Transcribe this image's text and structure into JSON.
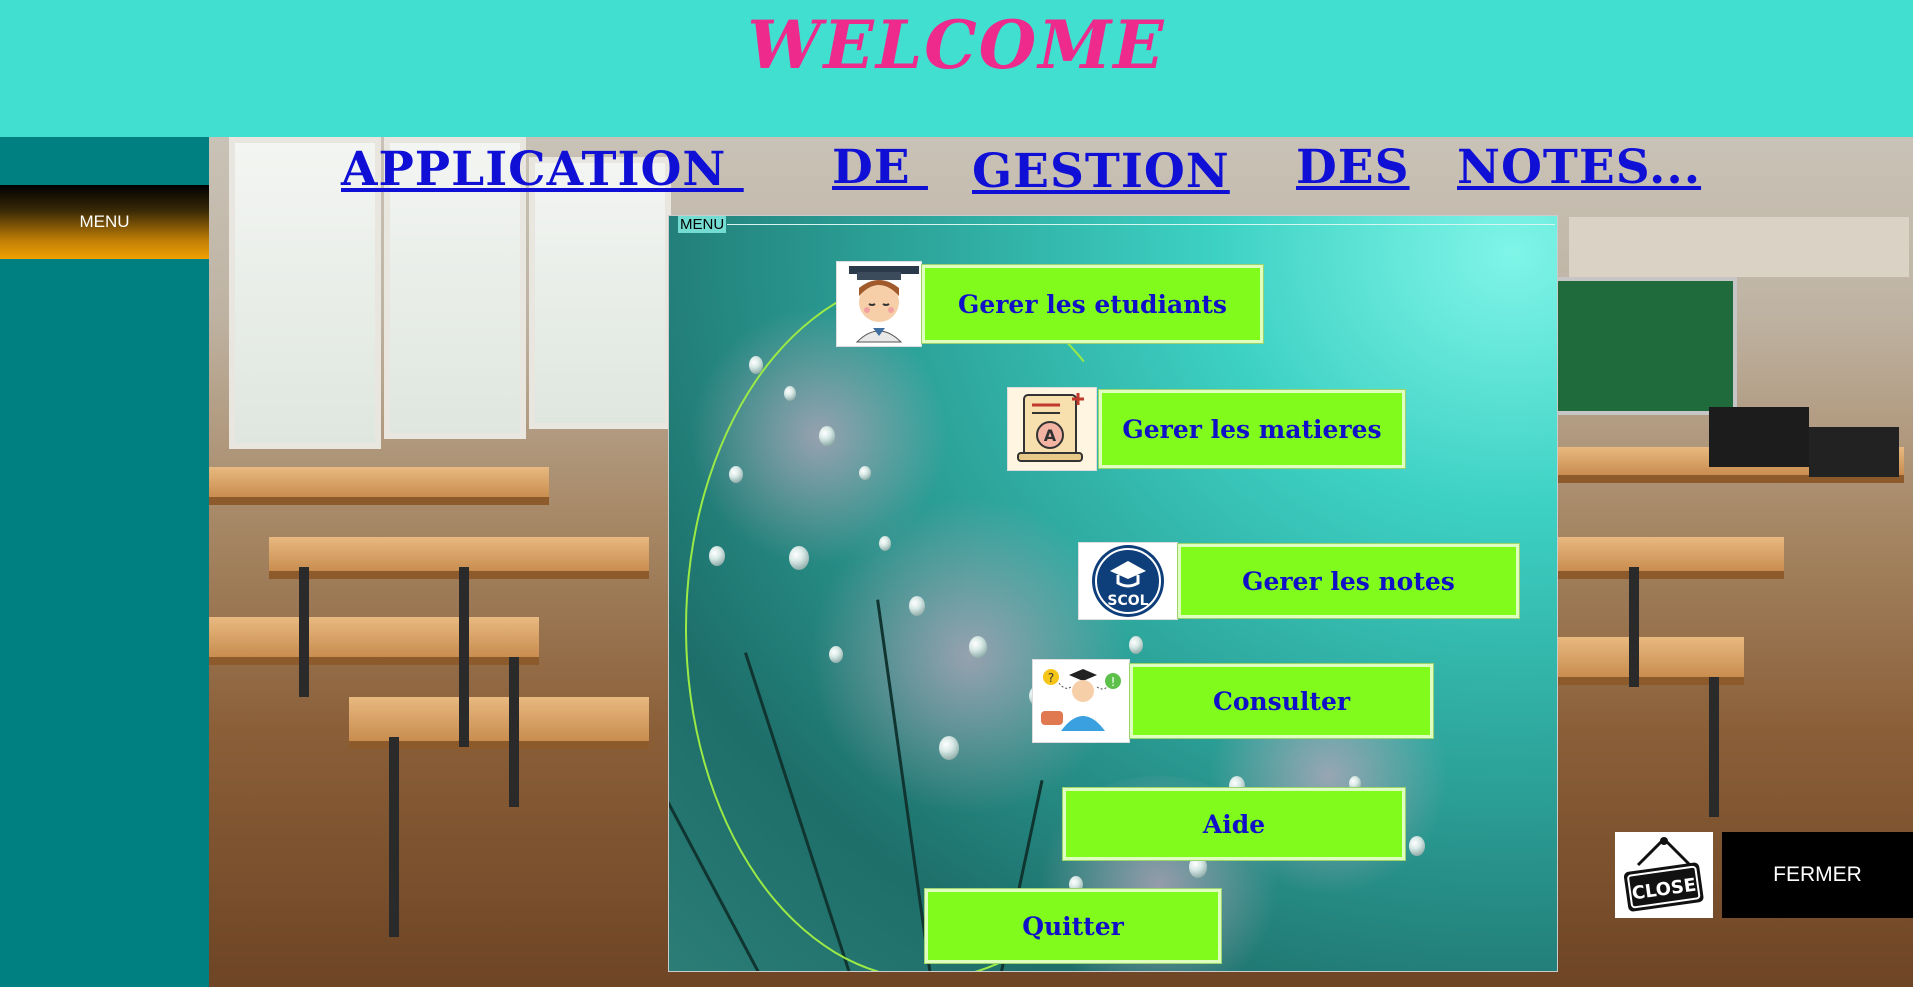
{
  "header": {
    "welcome": "WELCOME"
  },
  "sidebar": {
    "menu_label": "MENU"
  },
  "title": {
    "words": [
      "APPLICATION ",
      "DE ",
      "GESTION",
      "DES",
      "NOTES..."
    ]
  },
  "menu_panel": {
    "legend": "MENU",
    "items": [
      {
        "label": "Gerer les etudiants",
        "icon": "student-graduate-icon"
      },
      {
        "label": "Gerer les matieres",
        "icon": "diploma-certificate-icon"
      },
      {
        "label": "Gerer les notes",
        "icon": "scol-logo-icon",
        "icon_text": "SCOL"
      },
      {
        "label": "Consulter",
        "icon": "consult-person-icon"
      },
      {
        "label": "Aide"
      },
      {
        "label": "Quitter"
      }
    ]
  },
  "close": {
    "sign_text": "CLOSE",
    "button_label": "FERMER",
    "icon": "close-sign-icon"
  },
  "colors": {
    "header_bg": "#40dfd0",
    "welcome_text": "#ee2a8c",
    "sidebar_bg": "#008080",
    "title_text": "#0f0fd6",
    "menu_button_bg": "#80fb1c",
    "menu_button_text": "#1010c8",
    "fermer_bg": "#000000"
  }
}
